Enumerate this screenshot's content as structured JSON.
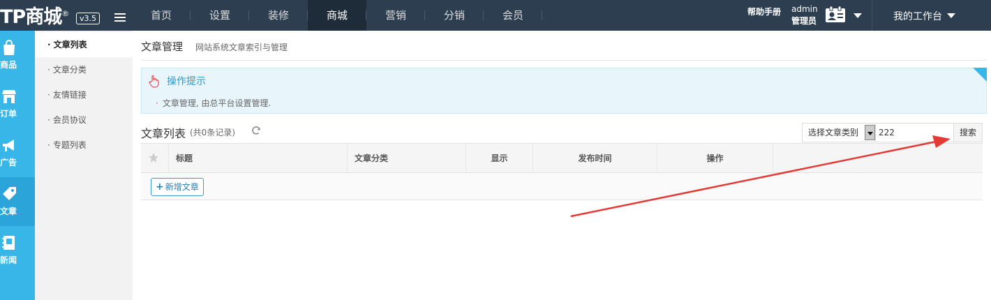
{
  "header": {
    "logo_text": "TP商城",
    "logo_mark": "®",
    "version": "v3.5",
    "nav": [
      "首页",
      "设置",
      "装修",
      "商城",
      "营销",
      "分销",
      "会员"
    ],
    "active_nav": "商城",
    "help": "帮助手册",
    "user_name": "admin",
    "user_role": "管理员",
    "workbench": "我的工作台"
  },
  "leftbar": {
    "items": [
      {
        "label": "商品",
        "icon": "shopping-bag-icon"
      },
      {
        "label": "订单",
        "icon": "store-icon"
      },
      {
        "label": "广告",
        "icon": "megaphone-icon"
      },
      {
        "label": "文章",
        "icon": "tag-icon"
      },
      {
        "label": "新闻",
        "icon": "notebook-icon"
      }
    ],
    "active": "文章"
  },
  "subnav": {
    "items": [
      "文章列表",
      "文章分类",
      "友情链接",
      "会员协议",
      "专题列表"
    ],
    "active": "文章列表"
  },
  "page": {
    "title": "文章管理",
    "description": "网站系统文章索引与管理"
  },
  "tips": {
    "title": "操作提示",
    "items": [
      "文章管理, 由总平台设置管理."
    ]
  },
  "list": {
    "title": "文章列表",
    "count": "(共0条记录)"
  },
  "search": {
    "category_selected": "选择文章类别",
    "keyword_value": "222",
    "button": "搜索"
  },
  "table": {
    "columns": [
      "标题",
      "文章分类",
      "显示",
      "发布时间",
      "操作"
    ],
    "rows": [],
    "add_button": "新增文章"
  },
  "colors": {
    "topbar": "#2c3e50",
    "sidebar": "#37b6e7",
    "annotation_arrow": "#e53935"
  }
}
